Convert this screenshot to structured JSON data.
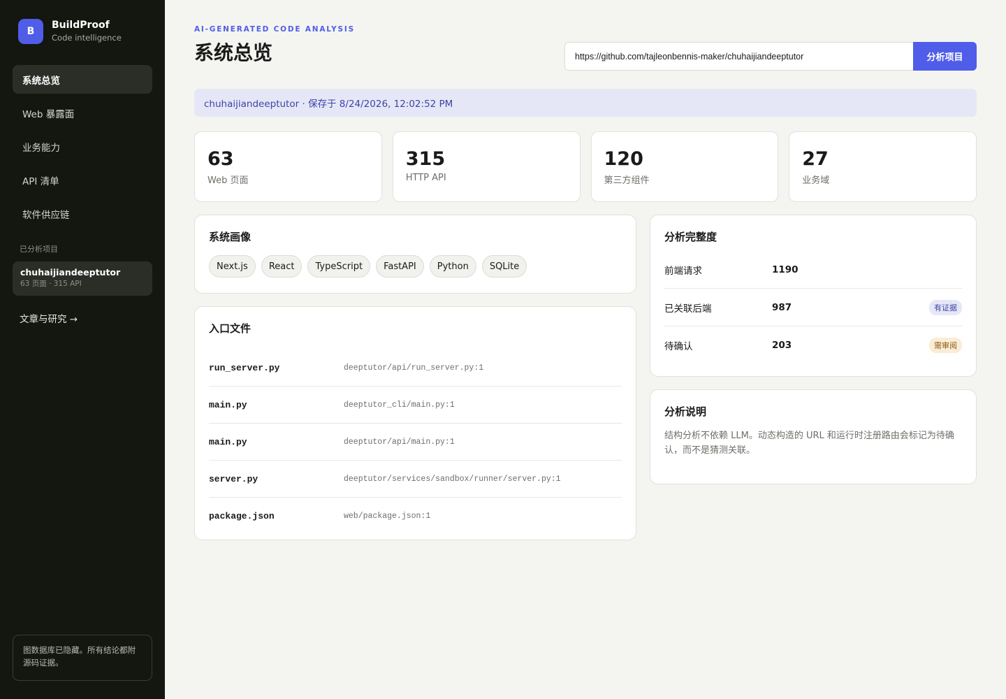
{
  "brand": {
    "logo_letter": "B",
    "name": "BuildProof",
    "subtitle": "Code intelligence"
  },
  "nav": {
    "items": [
      {
        "label": "系统总览",
        "active": true
      },
      {
        "label": "Web 暴露面",
        "active": false
      },
      {
        "label": "业务能力",
        "active": false
      },
      {
        "label": "API 清单",
        "active": false
      },
      {
        "label": "软件供应链",
        "active": false
      }
    ]
  },
  "projects": {
    "section_label": "已分析项目",
    "current": {
      "name": "chuhaijiandeeptutor",
      "meta": "63 页面 · 315 API"
    }
  },
  "articles_link": "文章与研究 →",
  "sidebar_note": "图数据库已隐藏。所有结论都附源码证据。",
  "header": {
    "eyebrow": "AI-GENERATED CODE ANALYSIS",
    "title": "系统总览",
    "repo_input_value": "https://github.com/tajleonbennis-maker/chuhaijiandeeptutor",
    "analyze_button": "分析项目"
  },
  "saved_banner": "chuhaijiandeeptutor · 保存于 8/24/2026, 12:02:52 PM",
  "stats": [
    {
      "value": "63",
      "label": "Web 页面"
    },
    {
      "value": "315",
      "label": "HTTP API"
    },
    {
      "value": "120",
      "label": "第三方组件"
    },
    {
      "value": "27",
      "label": "业务域"
    }
  ],
  "profile": {
    "title": "系统画像",
    "tags": [
      "Next.js",
      "React",
      "TypeScript",
      "FastAPI",
      "Python",
      "SQLite"
    ]
  },
  "entries": {
    "title": "入口文件",
    "rows": [
      {
        "name": "run_server.py",
        "path": "deeptutor/api/run_server.py:1"
      },
      {
        "name": "main.py",
        "path": "deeptutor_cli/main.py:1"
      },
      {
        "name": "main.py",
        "path": "deeptutor/api/main.py:1"
      },
      {
        "name": "server.py",
        "path": "deeptutor/services/sandbox/runner/server.py:1"
      },
      {
        "name": "package.json",
        "path": "web/package.json:1"
      }
    ]
  },
  "completeness": {
    "title": "分析完整度",
    "rows": [
      {
        "label": "前端请求",
        "value": "1190",
        "badge": ""
      },
      {
        "label": "已关联后端",
        "value": "987",
        "badge": "有证据"
      },
      {
        "label": "待确认",
        "value": "203",
        "badge": "需审阅"
      }
    ]
  },
  "notes": {
    "title": "分析说明",
    "text": "结构分析不依赖 LLM。动态构造的 URL 和运行时注册路由会标记为待确认，而不是猜测关联。"
  },
  "colors": {
    "accent": "#4f5de8",
    "sidebar_bg": "#141610",
    "page_bg": "#f4f4f0"
  }
}
